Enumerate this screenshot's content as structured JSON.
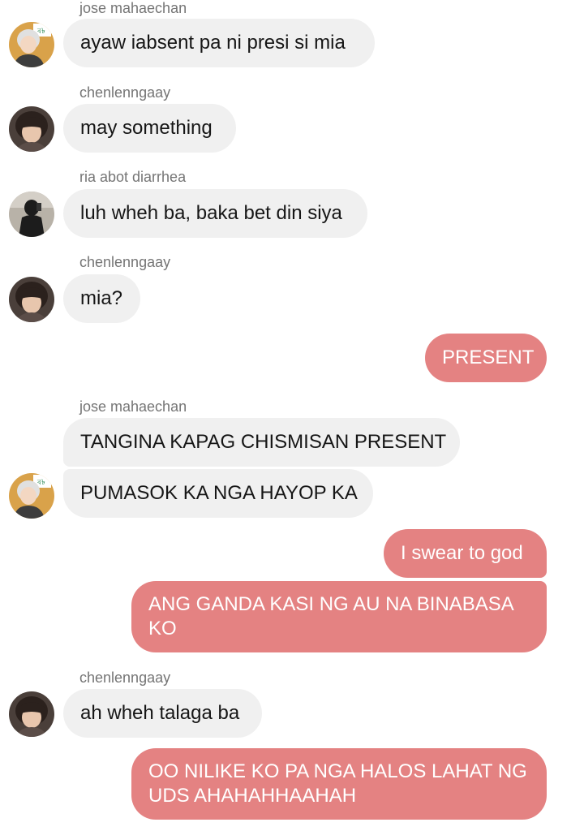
{
  "messages": [
    {
      "sender": "jose mahaechan",
      "text": "ayaw iabsent pa ni presi si mia"
    },
    {
      "sender": "chenlenngaay",
      "text": "may something"
    },
    {
      "sender": "ria abot diarrhea",
      "text": "luh wheh ba, baka bet din siya"
    },
    {
      "sender": "chenlenngaay",
      "text": "mia?"
    },
    {
      "text": "PRESENT"
    },
    {
      "sender": "jose mahaechan",
      "text": "TANGINA KAPAG CHISMISAN PRESENT"
    },
    {
      "text": "PUMASOK KA NGA HAYOP KA"
    },
    {
      "text": "I swear to god"
    },
    {
      "line1": "ANG GANDA KASI NG AU NA BINABASA",
      "line2": "KO"
    },
    {
      "sender": "chenlenngaay",
      "text": "ah wheh talaga ba"
    },
    {
      "line1": "OO NILIKE KO PA NGA HALOS LAHAT NG",
      "line2": "UDS AHAHAHHAAHAH"
    }
  ],
  "colors": {
    "incoming_bubble": "#f0f0f0",
    "outgoing_bubble": "#e48282",
    "sender_name": "#757575"
  },
  "avatars": [
    "jose-avatar",
    "chen-avatar",
    "ria-avatar",
    "chen-avatar",
    "jose-avatar",
    "chen-avatar"
  ]
}
